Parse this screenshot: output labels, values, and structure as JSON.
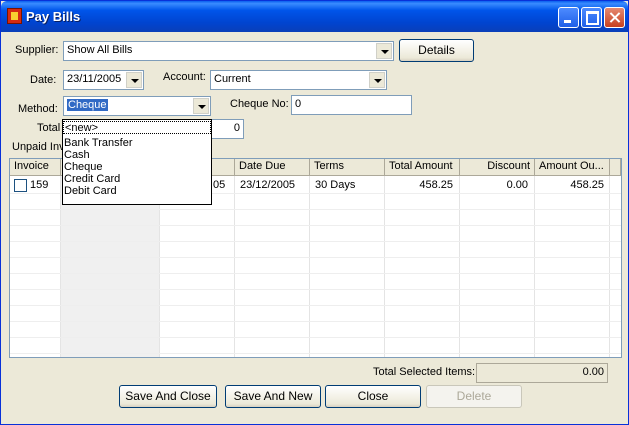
{
  "window": {
    "title": "Pay Bills"
  },
  "supplier": {
    "label": "Supplier:",
    "value": "Show All Bills",
    "details_label": "Details"
  },
  "date": {
    "label": "Date:",
    "value": "23/11/2005"
  },
  "account": {
    "label": "Account:",
    "value": "Current"
  },
  "method": {
    "label": "Method:",
    "value": "Cheque",
    "options": [
      "<new>",
      "Bank Transfer",
      "Cash",
      "Cheque",
      "Credit Card",
      "Debit Card"
    ]
  },
  "cheque": {
    "label": "Cheque No:",
    "value": "0"
  },
  "total": {
    "label": "Total",
    "value": "0"
  },
  "unpaid_label": "Unpaid Inv",
  "grid": {
    "columns": [
      "Invoice",
      "",
      "",
      "Date Due",
      "Terms",
      "Total Amount",
      "Discount",
      "Amount Ou..."
    ],
    "rows": [
      {
        "invoice": "159",
        "date_fragment": "05",
        "date_due": "23/12/2005",
        "terms": "30 Days",
        "total_amount": "458.25",
        "discount": "0.00",
        "amount_outstanding": "458.25"
      }
    ]
  },
  "total_selected": {
    "label": "Total Selected Items:",
    "value": "0.00"
  },
  "buttons": {
    "save_close": "Save And Close",
    "save_new": "Save And New",
    "close": "Close",
    "delete": "Delete"
  }
}
